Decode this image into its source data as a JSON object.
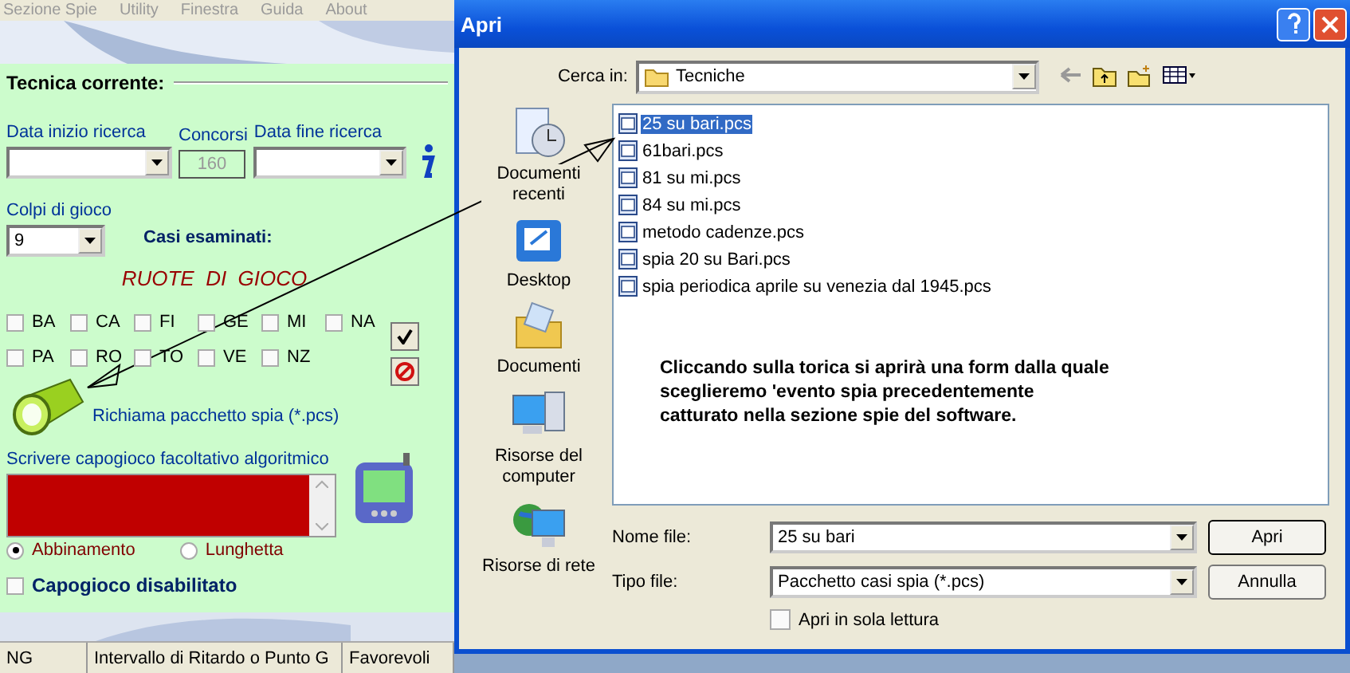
{
  "menu": [
    "Sezione Spie",
    "Utility",
    "Finestra",
    "Guida",
    "About"
  ],
  "panel": {
    "title": "Tecnica corrente:",
    "start_date_label": "Data inizio ricerca",
    "draws_label": "Concorsi",
    "draws_value": "160",
    "end_date_label": "Data fine ricerca",
    "plays_label": "Colpi di gioco",
    "plays_value": "9",
    "cases_label": "Casi esaminati:",
    "wheels_title": "RUOTE  DI  GIOCO",
    "wheels": [
      {
        "label": "BA",
        "checked": false
      },
      {
        "label": "CA",
        "checked": false
      },
      {
        "label": "FI",
        "checked": false
      },
      {
        "label": "GE",
        "checked": false
      },
      {
        "label": "MI",
        "checked": false
      },
      {
        "label": "NA",
        "checked": false
      },
      {
        "label": "PA",
        "checked": false
      },
      {
        "label": "RO",
        "checked": false
      },
      {
        "label": "TO",
        "checked": false
      },
      {
        "label": "VE",
        "checked": false
      },
      {
        "label": "NZ",
        "checked": false
      }
    ],
    "load_label": "Richiama pacchetto spia (*.pcs)",
    "formula_label": "Scrivere capogioco facoltativo algoritmico",
    "radios": [
      {
        "label": "Abbinamento",
        "selected": true
      },
      {
        "label": "Lunghetta",
        "selected": false
      }
    ],
    "disable": {
      "label": "Capogioco disabilitato",
      "checked": false
    }
  },
  "status_bar": [
    "NG",
    "Intervallo di Ritardo o Punto G",
    "Favorevoli"
  ],
  "dialog": {
    "title": "Apri",
    "look_in_label": "Cerca in:",
    "look_in_value": "Tecniche",
    "places": [
      {
        "label": "Documenti recenti",
        "kind": "recent"
      },
      {
        "label": "Desktop",
        "kind": "desktop"
      },
      {
        "label": "Documenti",
        "kind": "documents"
      },
      {
        "label": "Risorse del computer",
        "kind": "computer"
      },
      {
        "label": "Risorse di rete",
        "kind": "network"
      }
    ],
    "files": [
      {
        "name": "25 su bari.pcs",
        "selected": true
      },
      {
        "name": "61bari.pcs",
        "selected": false
      },
      {
        "name": "81 su mi.pcs",
        "selected": false
      },
      {
        "name": "84 su mi.pcs",
        "selected": false
      },
      {
        "name": "metodo cadenze.pcs",
        "selected": false
      },
      {
        "name": "spia 20 su Bari.pcs",
        "selected": false
      },
      {
        "name": "spia periodica aprile su venezia dal 1945.pcs",
        "selected": false
      }
    ],
    "note": [
      "Cliccando sulla torica si aprirà una form dalla quale",
      "sceglieremo 'evento spia precedentemente",
      "catturato nella sezione spie del software."
    ],
    "file_name_label": "Nome file:",
    "file_name_value": "25 su bari",
    "file_type_label": "Tipo file:",
    "file_type_value": "Pacchetto casi spia (*.pcs)",
    "read_only": {
      "label": "Apri in sola lettura",
      "checked": false
    },
    "buttons": [
      "Apri",
      "Annulla"
    ]
  }
}
